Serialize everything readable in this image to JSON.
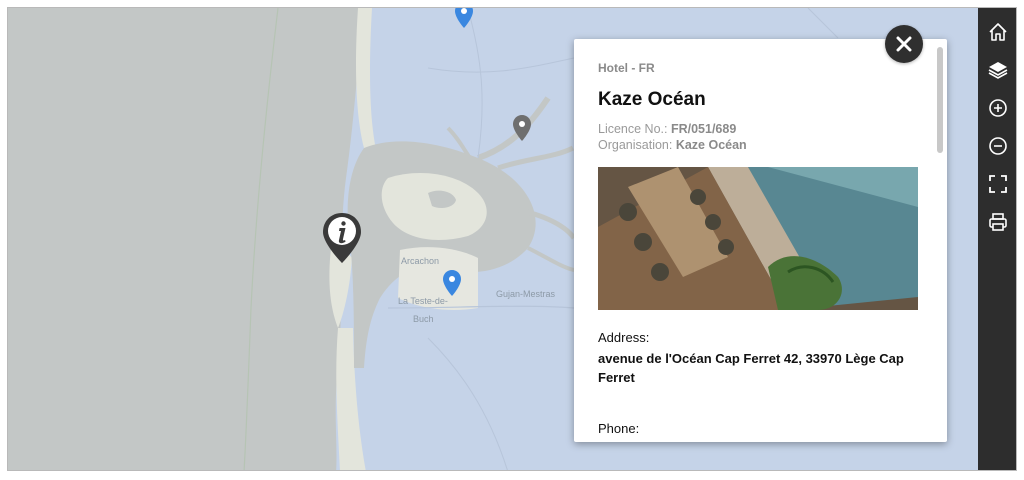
{
  "map": {
    "place_labels": [
      {
        "id": "arcachon",
        "text": "Arcachon"
      },
      {
        "id": "la-teste",
        "text": "La Teste-de-"
      },
      {
        "id": "buch",
        "text": "Buch"
      },
      {
        "id": "gujan",
        "text": "Gujan-Mestras"
      }
    ],
    "colors": {
      "ocean": "#c3c7c6",
      "land": "#c5d3e8",
      "sand": "#e3e5dc",
      "water": "#c3c7c6",
      "pin_blue": "#3a87e0",
      "pin_gray": "#6f6f6f"
    }
  },
  "toolbar": {
    "buttons": [
      {
        "name": "home-button",
        "icon": "home-icon"
      },
      {
        "name": "layers-button",
        "icon": "layers-icon"
      },
      {
        "name": "zoom-in-button",
        "icon": "plus-circle-icon"
      },
      {
        "name": "zoom-out-button",
        "icon": "minus-circle-icon"
      },
      {
        "name": "fullscreen-button",
        "icon": "fullscreen-icon"
      },
      {
        "name": "print-button",
        "icon": "print-icon"
      }
    ]
  },
  "popup": {
    "category": "Hotel - FR",
    "title": "Kaze Océan",
    "licence_label": "Licence No.: ",
    "licence_value": "FR/051/689",
    "organisation_label": "Organisation: ",
    "organisation_value": "Kaze Océan",
    "address_label": "Address:",
    "address_value": "avenue de l'Océan Cap Ferret 42, 33970 Lège Cap Ferret",
    "phone_label": "Phone:"
  }
}
